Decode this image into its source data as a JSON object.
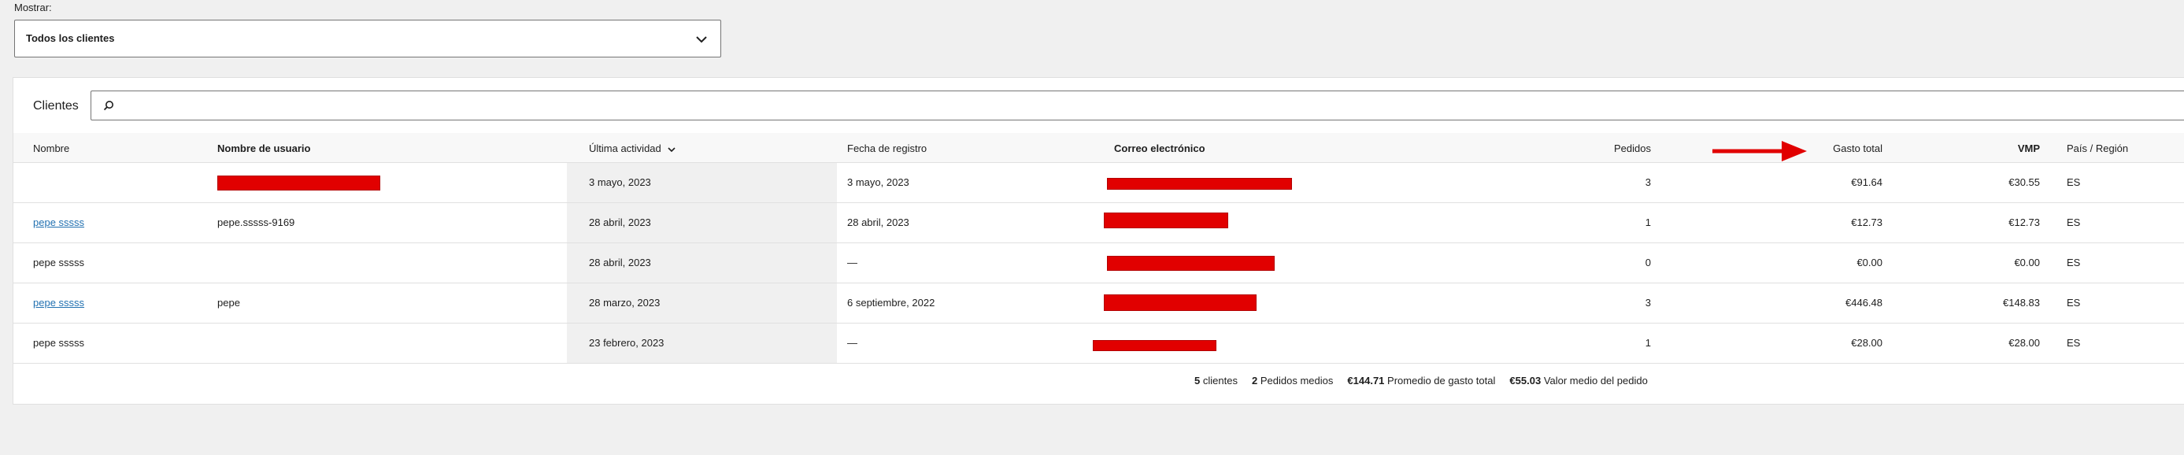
{
  "filter": {
    "label": "Mostrar:",
    "value": "Todos los clientes"
  },
  "card": {
    "title": "Clientes",
    "search_placeholder": ""
  },
  "columns": {
    "name": "Nombre",
    "username": "Nombre de usuario",
    "last_active": "Última actividad",
    "date_registered": "Fecha de registro",
    "email": "Correo electrónico",
    "orders": "Pedidos",
    "total_spend": "Gasto total",
    "aov": "VMP",
    "country": "País / Región"
  },
  "rows": [
    {
      "name": "",
      "username": "",
      "last_active": "3 mayo, 2023",
      "date_registered": "3 mayo, 2023",
      "orders": "3",
      "total_spend": "€91.64",
      "aov": "€30.55",
      "country": "ES"
    },
    {
      "name": "pepe sssss",
      "username": "pepe.sssss-9169",
      "last_active": "28 abril, 2023",
      "date_registered": "28 abril, 2023",
      "orders": "1",
      "total_spend": "€12.73",
      "aov": "€12.73",
      "country": "ES"
    },
    {
      "name": "pepe sssss",
      "username": "",
      "last_active": "28 abril, 2023",
      "date_registered": "—",
      "orders": "0",
      "total_spend": "€0.00",
      "aov": "€0.00",
      "country": "ES"
    },
    {
      "name": "pepe sssss",
      "username": "pepe",
      "last_active": "28 marzo, 2023",
      "date_registered": "6 septiembre, 2022",
      "orders": "3",
      "total_spend": "€446.48",
      "aov": "€148.83",
      "country": "ES"
    },
    {
      "name": "pepe sssss",
      "username": "",
      "last_active": "23 febrero, 2023",
      "date_registered": "—",
      "orders": "1",
      "total_spend": "€28.00",
      "aov": "€28.00",
      "country": "ES"
    }
  ],
  "summary": {
    "customers_count": "5",
    "customers_label": "clientes",
    "avg_orders": "2",
    "avg_orders_label": "Pedidos medios",
    "avg_spend": "€144.71",
    "avg_spend_label": "Promedio de gasto total",
    "aov_value": "€55.03",
    "aov_label": "Valor medio del pedido"
  },
  "colors": {
    "accent_link": "#2271b1",
    "redaction": "#e10000",
    "arrow": "#e10000"
  }
}
